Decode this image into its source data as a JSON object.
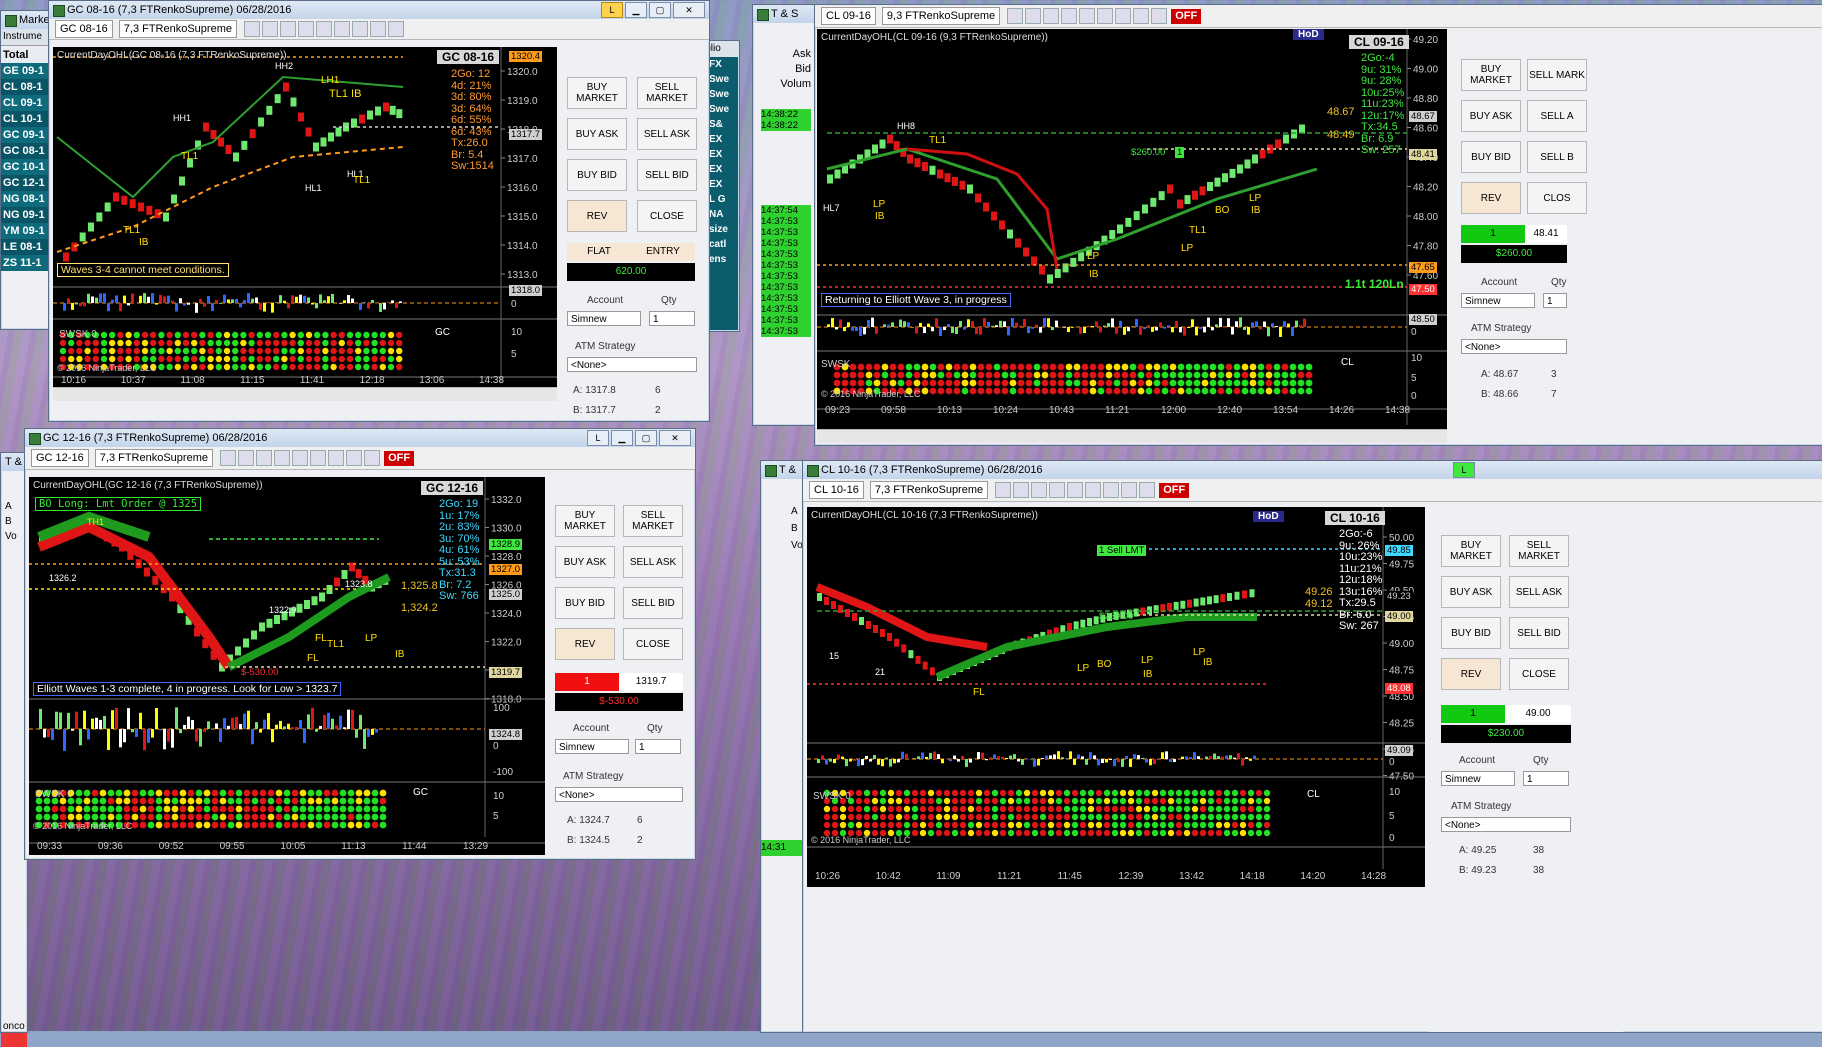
{
  "theme": {
    "up": "#5fd35f",
    "down": "#e01515",
    "bg": "#000000"
  },
  "market_analyzer": {
    "title": "Market A",
    "col_header": "Instrume",
    "rows": [
      "Total",
      "GE 09-1",
      "CL 08-1",
      "CL 09-1",
      "CL 10-1",
      "GC 09-1",
      "GC 08-1",
      "GC 10-1",
      "GC 12-1",
      "NG 08-1",
      "NG 09-1",
      "YM 09-1",
      "LE 08-1",
      "ZS 11-1"
    ]
  },
  "right_strip": {
    "header": "iplio",
    "cells": [
      "FX",
      "Swe",
      "Swe",
      "Swe",
      "S&",
      "EX",
      "EX",
      "EX",
      "EX",
      "L G",
      "NA",
      "size",
      "catl",
      "ens"
    ]
  },
  "ts1": {
    "title": "T & S",
    "ask_label": "Ask",
    "bid_label": "Bid",
    "vol_label": "Volum",
    "times": [
      "14:38:22",
      "14:38:22",
      "14:37:54",
      "14:37:53",
      "14:37:53",
      "14:37:53",
      "14:37:53",
      "14:37:53",
      "14:37:53",
      "14:37:53",
      "14:37:53",
      "14:37:53",
      "14:37:53",
      "14:37:53"
    ]
  },
  "ts_small_a": {
    "title": "T &",
    "ask": "A",
    "bid": "B",
    "vol": "Vo"
  },
  "ts_small_b": {
    "title": "T &",
    "ask": "A",
    "bid": "B",
    "vol": "Vo",
    "time": "14:31"
  },
  "bottom_labels": {
    "left": "onco"
  },
  "gc0816": {
    "title": "GC 08-16 (7,3 FTRenkoSupreme)  06/28/2016",
    "instrument": "GC 08-16",
    "bartype": "7,3 FTRenkoSupreme",
    "indicator": "CurrentDayOHL(GC 08-16 (7,3 FTRenkoSupreme))",
    "symbol_box": "GC 08-16",
    "stats": "2Go: 12\n4d: 21%\n3d: 80%\n3d: 64%\n6d: 55%\n6d: 43%\nTx:26.0\nBr: 5.4\nSw:1514",
    "message": "Waves 3-4 cannot meet conditions.",
    "prices": [
      "1320.0",
      "1319.0",
      "1318.0",
      "1317.0",
      "1316.0",
      "1315.0",
      "1314.0",
      "1313.0"
    ],
    "price_tag_top": "1320.4",
    "price_tag_last": "1317.7",
    "osc_top": "1318.0",
    "osc_zero": "0",
    "osc_ten": "10",
    "osc_five": "5",
    "times": [
      "10:16",
      "10:37",
      "11:08",
      "11:15",
      "11:41",
      "12:18",
      "13:06",
      "14:38"
    ],
    "swsk": "SWSK 0",
    "gc_lbl": "GC",
    "copyright": "© 2016 NinjaTrader, LLC",
    "labels": [
      "HH2",
      "LH1",
      "TL1",
      "IB",
      "HH1",
      "TL1",
      "TL1",
      "IB",
      "HL1",
      "HL1",
      "TL1"
    ],
    "buttons": {
      "buy_market": "BUY MARKET",
      "sell_market": "SELL MARKET",
      "buy_ask": "BUY ASK",
      "sell_ask": "SELL ASK",
      "buy_bid": "BUY BID",
      "sell_bid": "SELL BID",
      "rev": "REV",
      "close": "CLOSE"
    },
    "flat": "FLAT",
    "entry": "ENTRY",
    "pnl": "620.00",
    "account_label": "Account",
    "qty_label": "Qty",
    "account": "Simnew",
    "qty": "1",
    "atm_label": "ATM Strategy",
    "atm": "<None>",
    "ask_line": "A: 1317.8",
    "ask_qty": "6",
    "bid_line": "B: 1317.7",
    "bid_qty": "2",
    "win_lbl": "L"
  },
  "cl0916": {
    "instrument": "CL 09-16",
    "bartype": "9,3 FTRenkoSupreme",
    "indicator": "CurrentDayOHL(CL 09-16 (9,3 FTRenkoSupreme))",
    "symbol_box": "CL 09-16",
    "hod": "HoD",
    "stats": "2Go:-4\n9u: 31%\n9u: 28%\n10u:25%\n11u:23%\n12u:17%\nTx:34.5\nBr: 6.9\nSw: 257",
    "side_vals": "48.67\n\n48.49",
    "message": "Returning to Elliott Wave 3, in progress",
    "prices": [
      "49.20",
      "49.00",
      "48.80",
      "48.60",
      "48.40",
      "48.20",
      "48.00",
      "47.80",
      "47.60"
    ],
    "tag_4867": "48.67",
    "tag_4841": "48.41",
    "tag_4765": "47.65",
    "tag_4750": "47.50",
    "osc_top": "48.50",
    "osc_zero": "0",
    "osc_ten": "10",
    "osc_five": "5",
    "osc_zero2": "0",
    "pl": "$260.00",
    "pl_qty": "1",
    "times": [
      "09:23",
      "09:58",
      "10:13",
      "10:24",
      "10:43",
      "11:21",
      "12:00",
      "12:40",
      "13:54",
      "14:26",
      "14:38"
    ],
    "wave_text": "1.1t 120Ln",
    "off": "OFF",
    "swsk": "SWSK",
    "cl_lbl": "CL",
    "copyright": "© 2016 NinjaTrader, LLC",
    "buttons": {
      "buy_market": "BUY MARKET",
      "sell_market": "SELL MARK",
      "buy_ask": "BUY ASK",
      "sell_ask": "SELL A",
      "buy_bid": "BUY BID",
      "sell_bid": "SELL B",
      "rev": "REV",
      "close": "CLOS"
    },
    "pos_qty": "1",
    "pos_price": "48.41",
    "pos_pnl": "$260.00",
    "account_label": "Account",
    "qty_label": "Qty",
    "account": "Simnew",
    "qty": "1",
    "atm_label": "ATM Strategy",
    "atm": "<None>",
    "ask_line": "A: 48.67",
    "ask_qty": "3",
    "bid_line": "B: 48.66",
    "bid_qty": "7"
  },
  "gc1216": {
    "title": "GC 12-16 (7,3 FTRenkoSupreme)  06/28/2016",
    "instrument": "GC 12-16",
    "bartype": "7,3 FTRenkoSupreme",
    "indicator": "CurrentDayOHL(GC 12-16 (7,3 FTRenkoSupreme))",
    "symbol_box": "GC 12-16",
    "order_msg": "BO Long: Lmt Order @ 1325",
    "stats": "2Go: 19\n1u: 17%\n2u: 83%\n3u: 70%\n4u: 61%\n5u: 53%\nTx:31.3\nBr: 7.2\nSw: 766",
    "message": "Elliott Waves 1-3 complete, 4 in progress. Look for Low > 1323.7",
    "prices": [
      "1332.0",
      "1330.0",
      "1328.0",
      "1326.0",
      "1324.0",
      "1322.0",
      "1320.0",
      "1318.0"
    ],
    "tag_1328": "1328.9",
    "tag_1327": "1327.0",
    "tag_1325": "1325.0",
    "tag_1319": "1319.7",
    "side1": "1,325.8",
    "side2": "1,324.2",
    "pl": "$-530.00",
    "osc_top": "100",
    "osc_val": "1324.8",
    "osc_zero": "0",
    "osc_bot": "-100",
    "osc_ten": "10",
    "osc_five": "5",
    "times": [
      "09:33",
      "09:36",
      "09:52",
      "09:55",
      "10:05",
      "11:13",
      "11:44",
      "13:29"
    ],
    "swsk": "SWSK 0",
    "gc_lbl": "GC",
    "copyright": "© 2016 NinjaTrader, LLC",
    "off": "OFF",
    "buttons": {
      "buy_market": "BUY MARKET",
      "sell_market": "SELL MARKET",
      "buy_ask": "BUY ASK",
      "sell_ask": "SELL ASK",
      "buy_bid": "BUY BID",
      "sell_bid": "SELL BID",
      "rev": "REV",
      "close": "CLOSE"
    },
    "pos_qty": "1",
    "pos_price": "1319.7",
    "pos_pnl": "$-530.00",
    "account_label": "Account",
    "qty_label": "Qty",
    "account": "Simnew",
    "qty": "1",
    "atm_label": "ATM Strategy",
    "atm": "<None>",
    "ask_line": "A: 1324.7",
    "ask_qty": "6",
    "bid_line": "B: 1324.5",
    "bid_qty": "2",
    "win_lbl": "L"
  },
  "cl1016": {
    "title": "CL 10-16 (7,3 FTRenkoSupreme)  06/28/2016",
    "instrument": "CL 10-16",
    "bartype": "7,3 FTRenkoSupreme",
    "indicator": "CurrentDayOHL(CL 10-16 (7,3 FTRenkoSupreme))",
    "symbol_box": "CL 10-16",
    "hod": "HoD",
    "stats": "2Go:-6\n9u: 26%\n10u:23%\n11u:21%\n12u:18%\n13u:16%\nTx:29.5\nBr: 6.0\nSw: 267",
    "side_vals": "49.26\n49.12",
    "sell_lmt": "1  Sell LMT",
    "prices": [
      "50.00",
      "49.75",
      "49.50",
      "49.25",
      "49.00",
      "48.75",
      "48.50",
      "48.25",
      "47.75",
      "47.50"
    ],
    "tag_4985": "49.85",
    "tag_4923": "49.23",
    "tag_4900": "49.00",
    "tag_4808": "48.08",
    "osc_top": "49.09",
    "osc_zero": "0",
    "osc_ten": "10",
    "osc_five": "5",
    "osc_zero2": "0",
    "pl": "$230.00",
    "times": [
      "10:26",
      "10:42",
      "11:09",
      "11:21",
      "11:45",
      "12:39",
      "13:42",
      "14:18",
      "14:20",
      "14:28"
    ],
    "swsk": "SWSK 0",
    "cl_lbl": "CL",
    "copyright": "© 2016 NinjaTrader, LLC",
    "off": "OFF",
    "buttons": {
      "buy_market": "BUY MARKET",
      "sell_market": "SELL MARKET",
      "buy_ask": "BUY ASK",
      "sell_ask": "SELL ASK",
      "buy_bid": "BUY BID",
      "sell_bid": "SELL BID",
      "rev": "REV",
      "close": "CLOSE"
    },
    "pos_qty": "1",
    "pos_price": "49.00",
    "pos_pnl": "$230.00",
    "account_label": "Account",
    "qty_label": "Qty",
    "account": "Simnew",
    "qty": "1",
    "atm_label": "ATM Strategy",
    "atm": "<None>",
    "ask_line": "A: 49.25",
    "ask_qty": "38",
    "bid_line": "B: 49.23",
    "bid_qty": "38",
    "win_lbl": "L"
  }
}
